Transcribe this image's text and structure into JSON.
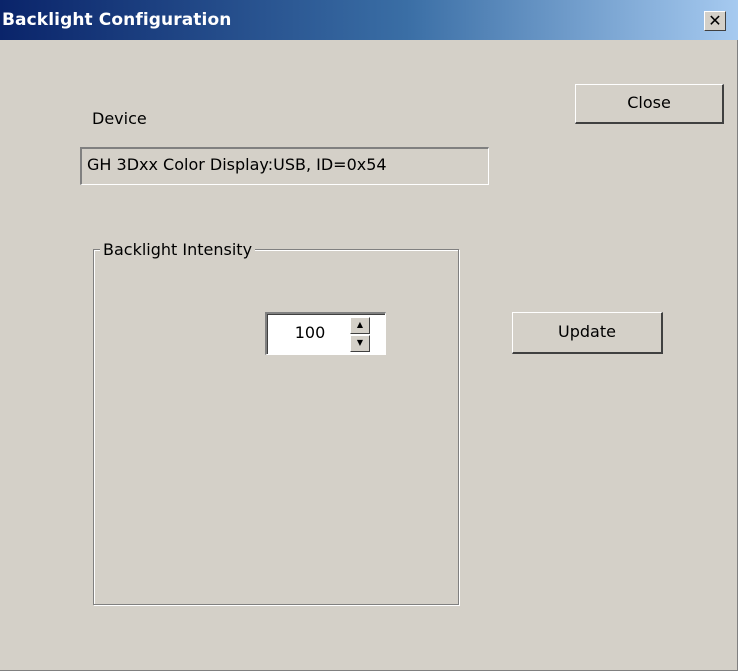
{
  "window": {
    "title": "Backlight Configuration",
    "close_glyph": "✕"
  },
  "device": {
    "label": "Device",
    "value": "GH 3Dxx Color Display:USB, ID=0x54"
  },
  "buttons": {
    "close_label": "Close",
    "update_label": "Update"
  },
  "intensity": {
    "group_label": "Backlight Intensity",
    "value": "100",
    "up_glyph": "▲",
    "down_glyph": "▼"
  },
  "icons": {
    "title_close": "close-icon",
    "spin_up": "arrow-up-icon",
    "spin_down": "arrow-down-icon"
  },
  "colors": {
    "dialog_background": "#d4d0c8",
    "titlebar_start": "#0a246a",
    "titlebar_end": "#a6caf0"
  }
}
